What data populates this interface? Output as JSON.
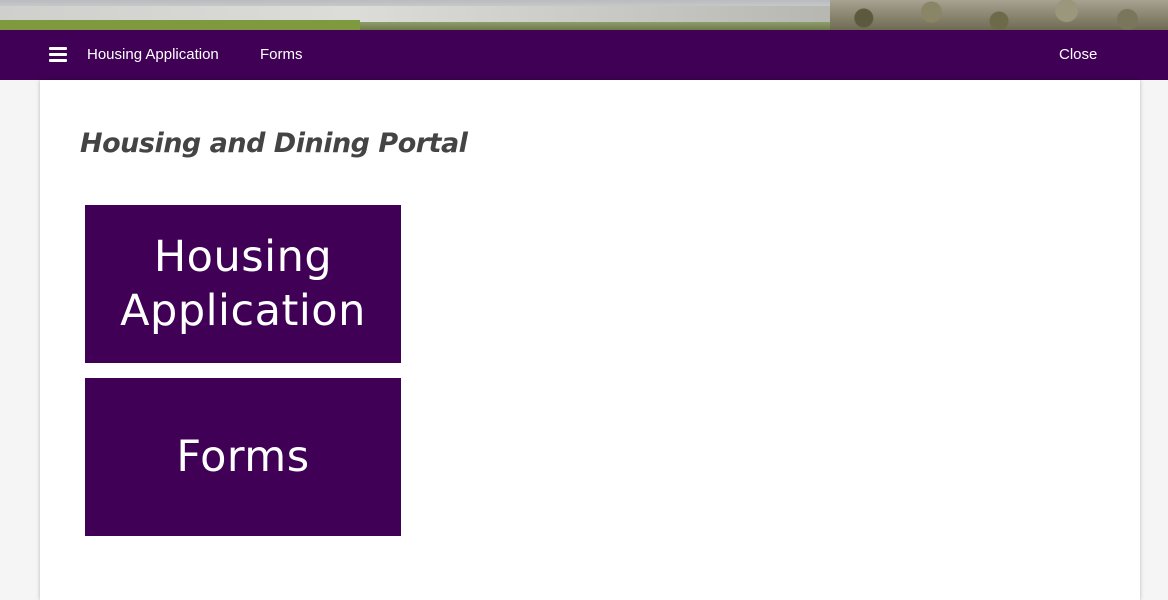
{
  "banner": {
    "image": "campus-landscape-photo"
  },
  "nav": {
    "menu_icon": "hamburger-menu-icon",
    "housing_application_label": "Housing Application",
    "forms_label": "Forms",
    "close_label": "Close"
  },
  "main": {
    "title": "Housing and Dining Portal",
    "tiles": [
      {
        "lines": [
          "Housing",
          "Application"
        ]
      },
      {
        "lines": [
          "Forms"
        ]
      }
    ]
  },
  "colors": {
    "brand_purple": "#400055",
    "text_gray": "#444444",
    "background": "#f5f5f5"
  }
}
